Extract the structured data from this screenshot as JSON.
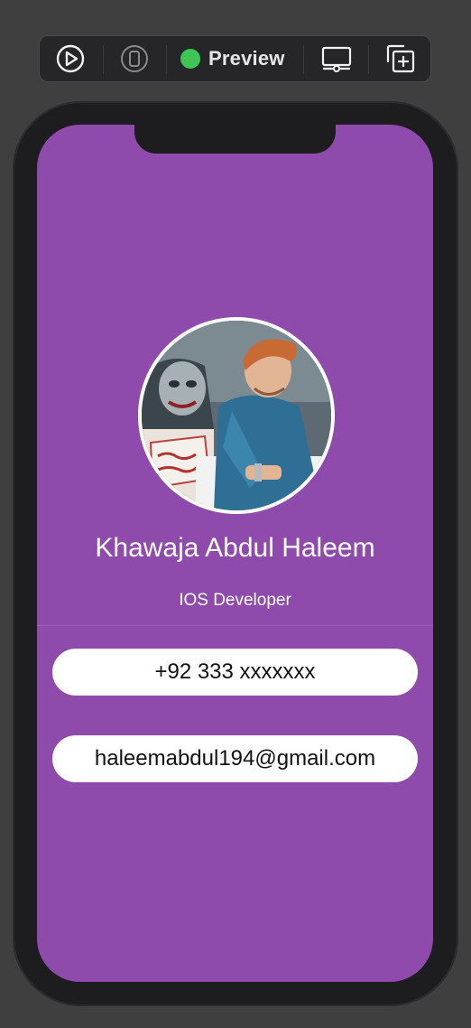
{
  "toolbar": {
    "preview_label": "Preview",
    "status_color": "#3fc553",
    "icons": [
      "play-circle-icon",
      "device-icon",
      "display-icon",
      "duplicate-icon"
    ]
  },
  "profile": {
    "name": "Khawaja Abdul Haleem",
    "role": "IOS Developer",
    "phone": "+92 333 xxxxxxx",
    "email": "haleemabdul194@gmail.com"
  },
  "colors": {
    "screen_background": "#8e4bab",
    "pill_background": "#ffffff",
    "canvas_background": "#3f3f3f"
  }
}
